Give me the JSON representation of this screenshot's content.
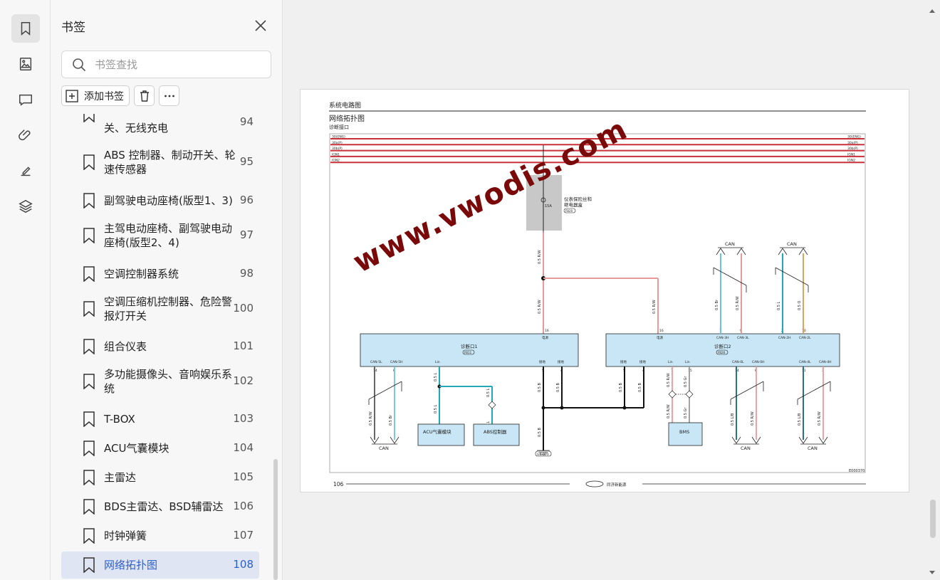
{
  "rail": {
    "items": [
      {
        "icon": "bookmark-icon",
        "active": true
      },
      {
        "icon": "image-icon",
        "active": false
      },
      {
        "icon": "comment-icon",
        "active": false
      },
      {
        "icon": "attachment-icon",
        "active": false
      },
      {
        "icon": "signature-icon",
        "active": false
      },
      {
        "icon": "layers-icon",
        "active": false
      }
    ]
  },
  "panel": {
    "title": "书签",
    "search_placeholder": "书签查找",
    "add_label": "添加书签",
    "bookmarks": [
      {
        "title": "关、无线充电",
        "page": "94",
        "lines": 1,
        "partial": true
      },
      {
        "title": "ABS 控制器、制动开关、轮速传感器",
        "page": "95",
        "lines": 2
      },
      {
        "title": "副驾驶电动座椅(版型1、3)",
        "page": "96",
        "lines": 1
      },
      {
        "title": "主驾电动座椅、副驾驶电动座椅(版型2、4)",
        "page": "97",
        "lines": 2
      },
      {
        "title": "空调控制器系统",
        "page": "98",
        "lines": 1
      },
      {
        "title": "空调压缩机控制器、危险警报灯开关",
        "page": "100",
        "lines": 2
      },
      {
        "title": "组合仪表",
        "page": "101",
        "lines": 1
      },
      {
        "title": "多功能摄像头、音响娱乐系统",
        "page": "102",
        "lines": 2
      },
      {
        "title": "T-BOX",
        "page": "103",
        "lines": 1
      },
      {
        "title": "ACU气囊模块",
        "page": "104",
        "lines": 1
      },
      {
        "title": "主雷达",
        "page": "105",
        "lines": 1
      },
      {
        "title": "BDS主雷达、BSD辅雷达",
        "page": "106",
        "lines": 1
      },
      {
        "title": "时钟弹簧",
        "page": "107",
        "lines": 1
      },
      {
        "title": "网络拓扑图",
        "page": "108",
        "lines": 1,
        "selected": true
      }
    ]
  },
  "document": {
    "header": "系统电路图",
    "title": "网络拓扑图",
    "subtitle": "诊断接口",
    "page_number": "106",
    "diagram_code": "E000370",
    "power_rails": [
      {
        "label": "30(ENG)"
      },
      {
        "label": "30a(P)"
      },
      {
        "label": "30b(P)"
      },
      {
        "label": "IGN1"
      },
      {
        "label": "IGN2"
      }
    ],
    "fuse_box": {
      "label_line1": "仪表保险丝和",
      "label_line2": "继电器盒",
      "code": "FB20",
      "fuse": "15A"
    },
    "diag1": {
      "title": "诊断口1",
      "code": "FB11",
      "pins": [
        "CAN-5L",
        "CAN-5H",
        "Lin",
        "接地",
        "接地",
        "电源"
      ],
      "pin_numbers": [
        "14",
        "6",
        "7",
        "5",
        "4",
        "16"
      ]
    },
    "diag2": {
      "title": "诊断口2",
      "code": "FB26",
      "pins": [
        "接地",
        "接地",
        "Lin",
        "Lin",
        "CAN-0L",
        "CAN-0H",
        "CAN-4L",
        "CAN-4H",
        "电源",
        "CAN-3H",
        "CAN-3L",
        "CAN-2H",
        "CAN-2L"
      ],
      "pin_numbers": [
        "5",
        "4",
        "7",
        "15",
        "14",
        "6",
        "11",
        "3",
        "16",
        "1",
        "9",
        "2",
        "10"
      ]
    },
    "modules": {
      "acu": "ACU气囊模块",
      "abs": "ABS控制器",
      "bms": "BMS"
    },
    "can_label": "CAN",
    "ground": "G8-003",
    "wires": [
      "0.5 R/W",
      "0.5 L",
      "0.5 B",
      "0.5 Gr",
      "0.5 R/W",
      "0.5 Br",
      "0.5 L/B",
      "0.5 O"
    ],
    "footer_brand": "同济新能源"
  },
  "watermark": "www.vwodis.com",
  "colors": {
    "rail_red": "#c8303a",
    "wire_pink": "#e89a9a",
    "wire_cyan": "#24a8b8",
    "wire_blue": "#6bc3e0",
    "wire_orange": "#d8a65c",
    "module_fill": "#c8e6f5",
    "selected_bg": "#dfe5f3",
    "accent": "#2f5fc8",
    "watermark": "#7a0a0a"
  }
}
